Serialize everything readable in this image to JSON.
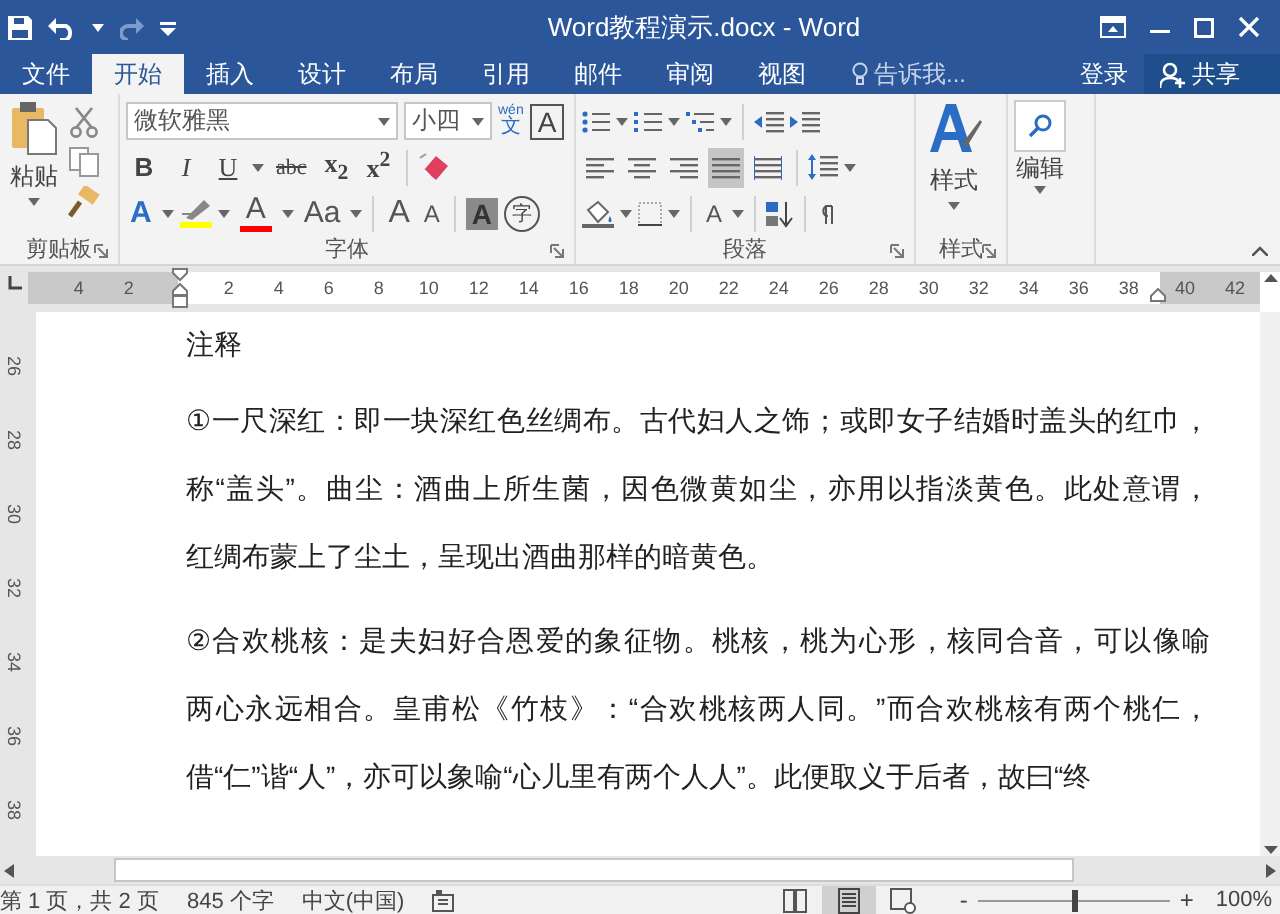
{
  "window": {
    "title": "Word教程演示.docx - Word"
  },
  "tabs": [
    {
      "label": "文件",
      "selected": false
    },
    {
      "label": "开始",
      "selected": true
    },
    {
      "label": "插入",
      "selected": false
    },
    {
      "label": "设计",
      "selected": false
    },
    {
      "label": "布局",
      "selected": false
    },
    {
      "label": "引用",
      "selected": false
    },
    {
      "label": "邮件",
      "selected": false
    },
    {
      "label": "审阅",
      "selected": false
    },
    {
      "label": "视图",
      "selected": false
    }
  ],
  "tell_me": {
    "placeholder": "告诉我..."
  },
  "sign_in": "登录",
  "share": "共享",
  "ribbon": {
    "clipboard": {
      "paste": "粘贴",
      "label": "剪贴板"
    },
    "font": {
      "font_name": "微软雅黑",
      "font_size": "小四",
      "phonetic": "wén",
      "phonetic_char": "文",
      "border_char": "A",
      "format_buttons": [
        {
          "kind": "bold",
          "label": "B"
        },
        {
          "kind": "italic",
          "label": "I"
        },
        {
          "kind": "underline",
          "label": "U"
        },
        {
          "kind": "strike",
          "label": "abc"
        },
        {
          "kind": "script",
          "label": "x$_{2}$"
        },
        {
          "kind": "script",
          "label": "x$^{2}$"
        }
      ],
      "text_effect": "A",
      "font_color_label": "A",
      "case": "Aa",
      "grow": "A",
      "shrink": "A",
      "shading": "A",
      "enclosed": "字",
      "label": "字体"
    },
    "paragraph": {
      "label": "段落",
      "sort_label": "A",
      "alignments": [
        {
          "kind": "left",
          "selected": false
        },
        {
          "kind": "center",
          "selected": false
        },
        {
          "kind": "right",
          "selected": false
        },
        {
          "kind": "justify",
          "selected": true
        },
        {
          "kind": "distribute",
          "selected": false
        }
      ]
    },
    "styles": {
      "button": "样式",
      "label": "样式"
    },
    "editing": {
      "button": "编辑"
    }
  },
  "ruler": {
    "left_labels": [
      "4",
      "2"
    ],
    "labels": [
      "2",
      "4",
      "6",
      "8",
      "10",
      "12",
      "14",
      "16",
      "18",
      "20",
      "22",
      "24",
      "26",
      "28",
      "30",
      "32",
      "34",
      "36",
      "38"
    ],
    "right_labels": [
      "40",
      "42"
    ]
  },
  "vertical_ruler": {
    "labels": [
      "26",
      "28",
      "30",
      "32",
      "34",
      "36",
      "38"
    ]
  },
  "document": {
    "heading": "注释",
    "paragraphs": [
      {
        "lines": [
          "①一尺深红：即一块深红色丝绸布。古代妇人之饰；或即女子结婚时盖头的红巾，",
          "称“盖头”。曲尘：酒曲上所生菌，因色微黄如尘，亦用以指淡黄色。此处意谓，",
          "红绸布蒙上了尘土，呈现出酒曲那样的暗黄色。"
        ]
      },
      {
        "lines": [
          "②合欢桃核：是夫妇好合恩爱的象征物。桃核，桃为心形，核同合音，可以像喻",
          "两心永远相合。皇甫松《竹枝》：“合欢桃核两人同。”而合欢桃核有两个桃仁，",
          "借“仁”谐“人”，亦可以象喻“心儿里有两个人人”。此便取义于后者，故曰“终"
        ]
      }
    ]
  },
  "status_bar": {
    "page": "第 1 页，共 2 页",
    "words": "845 个字",
    "language": "中文(中国)",
    "views": [
      {
        "kind": "read",
        "selected": false
      },
      {
        "kind": "print",
        "selected": true
      },
      {
        "kind": "web",
        "selected": false
      }
    ],
    "zoom_out": "-",
    "zoom_in": "+",
    "zoom_slider": {
      "level": 0.5
    },
    "zoom": "100%"
  }
}
